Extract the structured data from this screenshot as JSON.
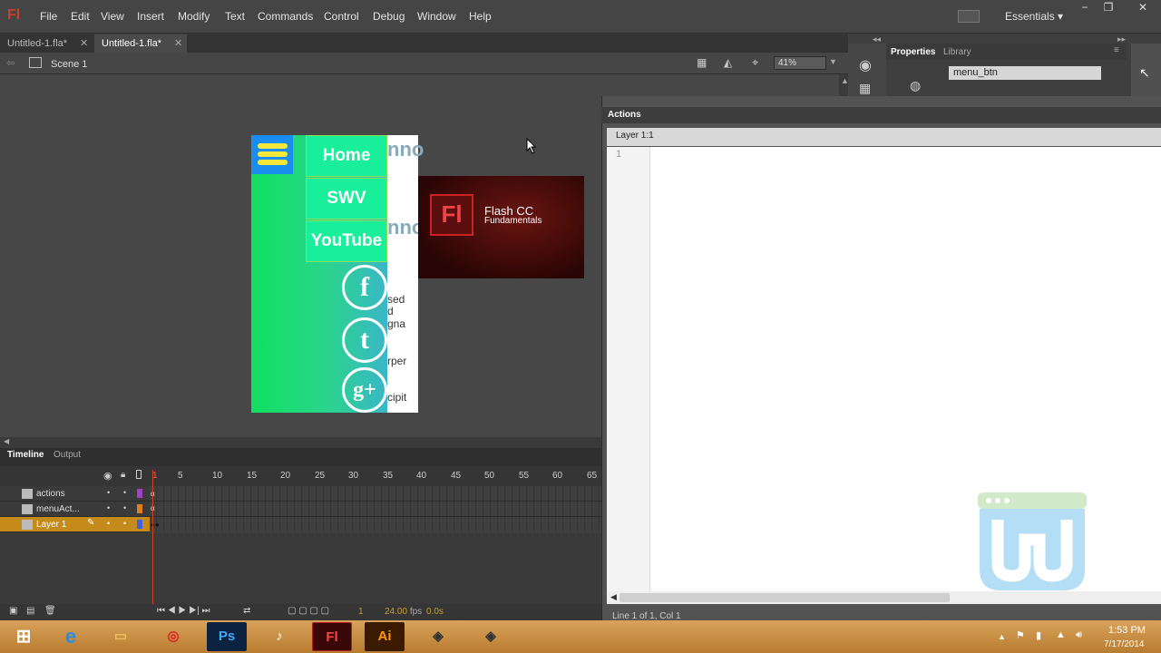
{
  "app": {
    "logo": "Fl"
  },
  "menu": [
    "File",
    "Edit",
    "View",
    "Insert",
    "Modify",
    "Text",
    "Commands",
    "Control",
    "Debug",
    "Window",
    "Help"
  ],
  "workspace": "Essentials",
  "window_controls": [
    "−",
    "❐",
    "✕"
  ],
  "tabs": [
    {
      "label": "Untitled-1.fla*",
      "close": "✕"
    },
    {
      "label": "Untitled-1.fla*",
      "close": "✕"
    }
  ],
  "editbar": {
    "scene": "Scene 1",
    "zoom": "41%"
  },
  "stage": {
    "nav_buttons": [
      "Home",
      "SWV",
      "YouTube"
    ],
    "social_icons": [
      "f",
      "t",
      "g+"
    ],
    "peek_text": [
      "nno",
      "nno",
      "sed",
      "d",
      "gna",
      "rper",
      "cipit"
    ],
    "banner": {
      "logo": "Fl",
      "title": "Flash CC",
      "subtitle": "Fundamentals"
    }
  },
  "properties": {
    "tabs": [
      "Properties",
      "Library"
    ],
    "instance_name": "menu_btn"
  },
  "actions": {
    "title": "Actions",
    "script_nav": "Layer 1:1",
    "line_number": "1",
    "status": "Line 1 of 1, Col 1"
  },
  "timeline": {
    "tabs": [
      "Timeline",
      "Output"
    ],
    "frame_numbers": [
      "1",
      "5",
      "10",
      "15",
      "20",
      "25",
      "30",
      "35",
      "40",
      "45",
      "50",
      "55",
      "60",
      "65"
    ],
    "layers": [
      {
        "name": "actions",
        "color": "#a040c0",
        "selected": false
      },
      {
        "name": "menuAct...",
        "color": "#e08020",
        "selected": false
      },
      {
        "name": "Layer 1",
        "color": "#4060e0",
        "selected": true
      }
    ],
    "footer": {
      "frame": "1",
      "fps": "24.00",
      "fps_unit": "fps",
      "time": "0.0s"
    }
  },
  "taskbar": {
    "apps": [
      "start",
      "ie",
      "explorer",
      "chrome",
      "photoshop",
      "media",
      "flash",
      "illustrator",
      "app9",
      "app10"
    ],
    "time": "1:53 PM",
    "date": "7/17/2014"
  },
  "colors": {
    "accent_flash": "#c8422a",
    "selected_layer": "#c48a1a"
  }
}
